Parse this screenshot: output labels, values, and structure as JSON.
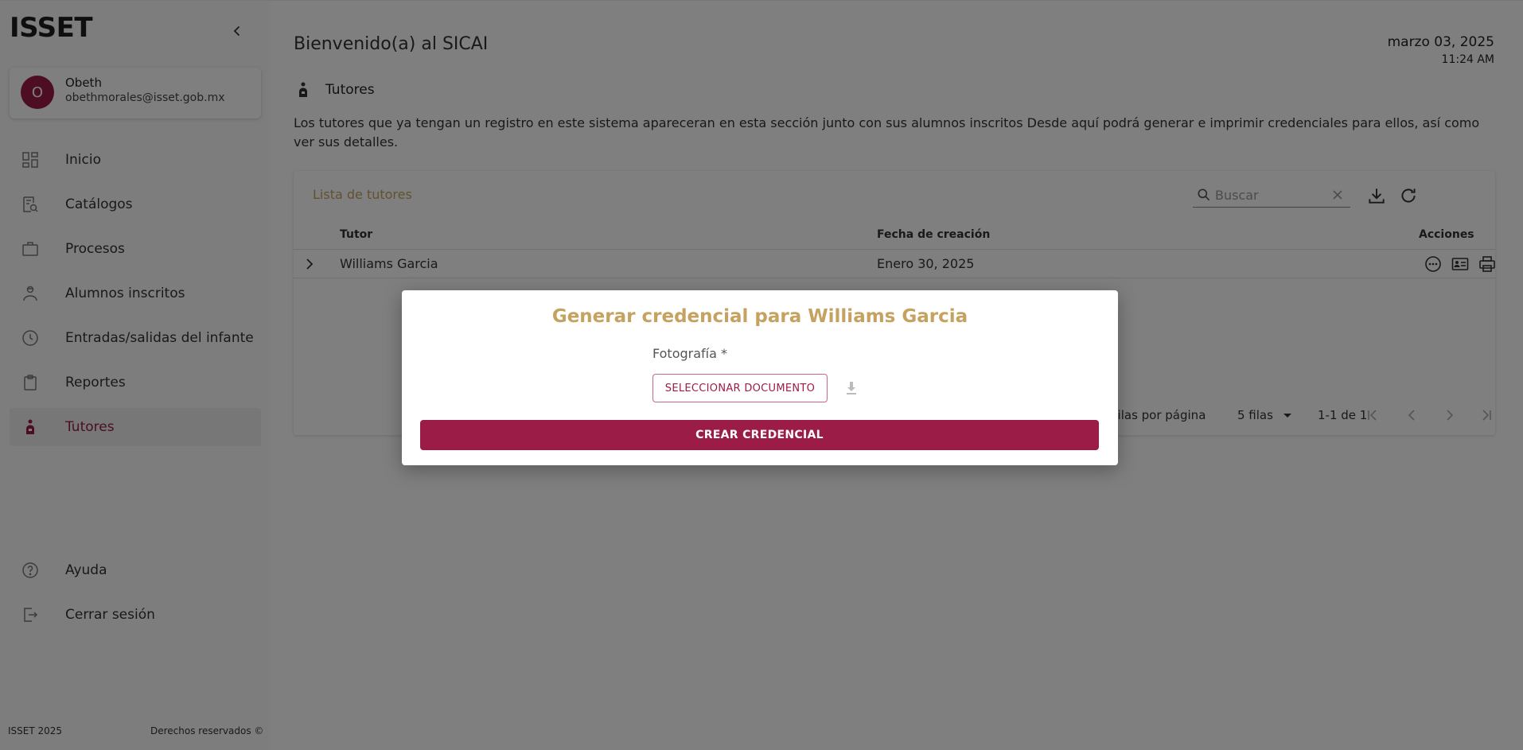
{
  "app": {
    "brand": "ISSET"
  },
  "user": {
    "initial": "O",
    "name": "Obeth",
    "email": "obethmorales@isset.gob.mx"
  },
  "nav": {
    "items": [
      {
        "label": "Inicio",
        "icon": "dashboard-icon"
      },
      {
        "label": "Catálogos",
        "icon": "catalog-search-icon"
      },
      {
        "label": "Procesos",
        "icon": "briefcase-icon"
      },
      {
        "label": "Alumnos inscritos",
        "icon": "student-icon"
      },
      {
        "label": "Entradas/salidas del infante",
        "icon": "clock-icon"
      },
      {
        "label": "Reportes",
        "icon": "clipboard-icon"
      },
      {
        "label": "Tutores",
        "icon": "tutor-icon"
      }
    ],
    "active": "Tutores",
    "bottom": [
      {
        "label": "Ayuda",
        "icon": "help-icon"
      },
      {
        "label": "Cerrar sesión",
        "icon": "logout-icon"
      }
    ]
  },
  "footer": {
    "left": "ISSET 2025",
    "right": "Derechos reservados ©"
  },
  "header": {
    "welcome": "Bienvenido(a) al SICAI",
    "date": "marzo 03, 2025",
    "time": "11:24 AM"
  },
  "section": {
    "title": "Tutores",
    "description": "Los tutores que ya tengan un registro en este sistema apareceran en esta sección junto con sus alumnos inscritos Desde aquí podrá generar e imprimir credenciales para ellos, así como ver sus detalles."
  },
  "table": {
    "caption": "Lista de tutores",
    "search_placeholder": "Buscar",
    "columns": {
      "tutor": "Tutor",
      "created": "Fecha de creación",
      "actions": "Acciones"
    },
    "rows": [
      {
        "tutor": "Williams Garcia",
        "created": "Enero 30, 2025"
      }
    ],
    "pagination": {
      "rows_per_page_label": "Filas por página",
      "rows_per_page": "5 filas",
      "range": "1-1 de 1"
    }
  },
  "modal": {
    "title": "Generar credencial para Williams Garcia",
    "field_label": "Fotografía *",
    "select_button": "SELECCIONAR DOCUMENTO",
    "submit_button": "CREAR CREDENCIAL"
  },
  "colors": {
    "primary": "#9b1d47",
    "accent": "#c5a25f"
  }
}
